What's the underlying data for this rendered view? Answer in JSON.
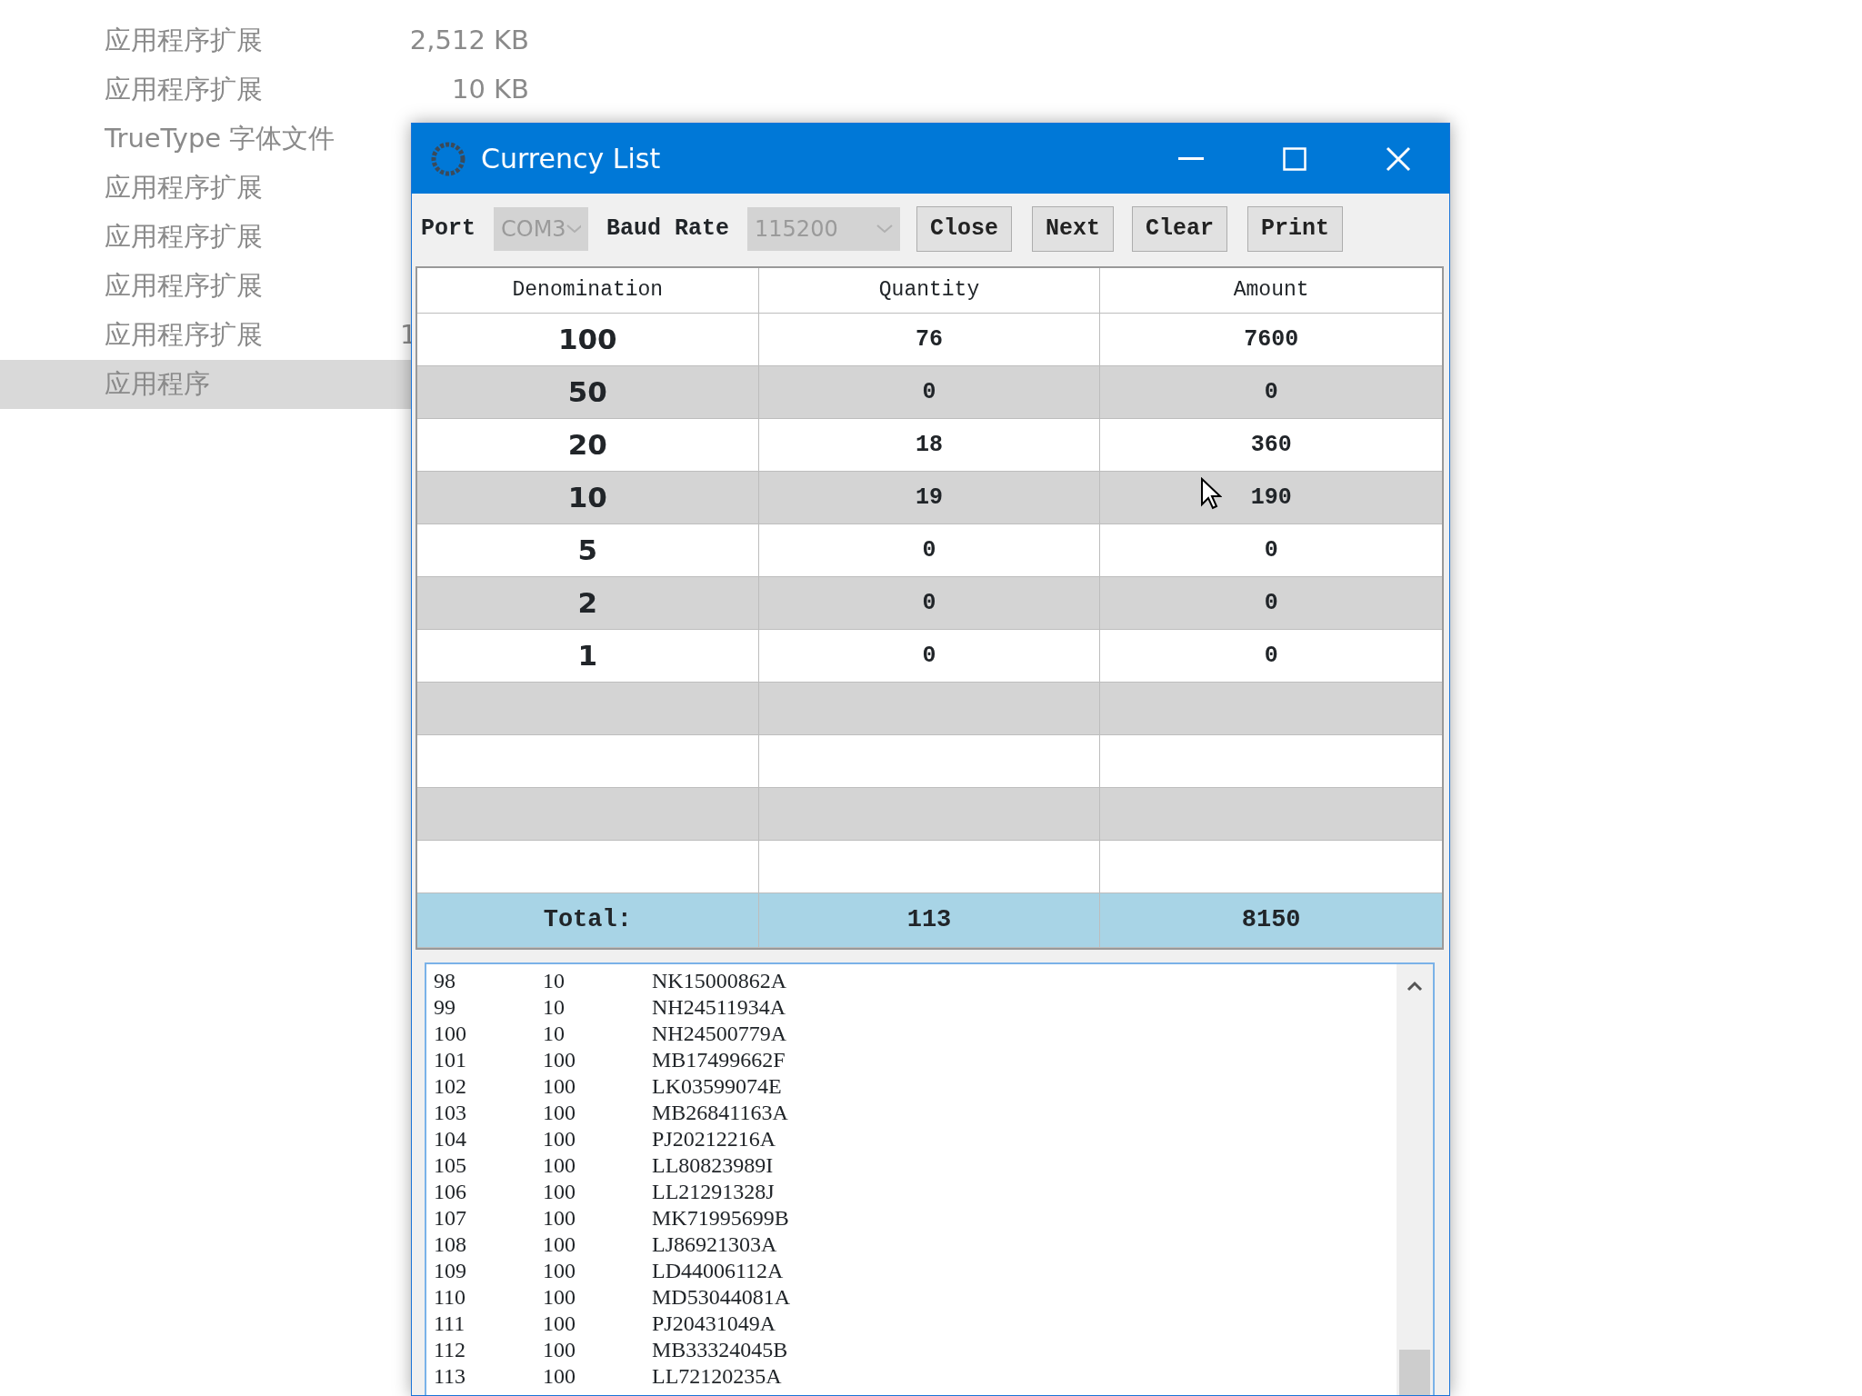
{
  "explorer": {
    "items": [
      {
        "type": "应用程序扩展",
        "size": "2,512 KB",
        "selected": false
      },
      {
        "type": "应用程序扩展",
        "size": "10 KB",
        "selected": false
      },
      {
        "type": "TrueType 字体文件",
        "selected": false
      },
      {
        "type": "应用程序扩展",
        "selected": false
      },
      {
        "type": "应用程序扩展",
        "selected": false
      },
      {
        "type": "应用程序扩展",
        "selected": false
      },
      {
        "type": "应用程序扩展",
        "size": "1",
        "clipped": true,
        "selected": false
      },
      {
        "type": "应用程序",
        "selected": true
      }
    ]
  },
  "window": {
    "title": "Currency List",
    "toolbar": {
      "port_label": "Port",
      "port": {
        "value": "COM3",
        "disabled": true
      },
      "baud_label": "Baud Rate",
      "baud": {
        "value": "115200",
        "disabled": true
      },
      "buttons": [
        "Close",
        "Next",
        "Clear",
        "Print"
      ]
    },
    "table": {
      "columns": [
        "Denomination",
        "Quantity",
        "Amount"
      ],
      "rows": [
        {
          "denomination": "100",
          "quantity": "76",
          "amount": "7600"
        },
        {
          "denomination": "50",
          "quantity": "0",
          "amount": "0"
        },
        {
          "denomination": "20",
          "quantity": "18",
          "amount": "360"
        },
        {
          "denomination": "10",
          "quantity": "19",
          "amount": "190"
        },
        {
          "denomination": "5",
          "quantity": "0",
          "amount": "0"
        },
        {
          "denomination": "2",
          "quantity": "0",
          "amount": "0"
        },
        {
          "denomination": "1",
          "quantity": "0",
          "amount": "0"
        },
        {
          "kind": "blank"
        },
        {
          "kind": "blank"
        },
        {
          "kind": "blank"
        },
        {
          "kind": "blank"
        }
      ],
      "total": {
        "label": "Total:",
        "quantity": "113",
        "amount": "8150"
      }
    },
    "log": [
      [
        "98",
        "10",
        "NK15000862A"
      ],
      [
        "99",
        "10",
        "NH24511934A"
      ],
      [
        "100",
        "10",
        "NH24500779A"
      ],
      [
        "101",
        "100",
        "MB17499662F"
      ],
      [
        "102",
        "100",
        "LK03599074E"
      ],
      [
        "103",
        "100",
        "MB26841163A"
      ],
      [
        "104",
        "100",
        "PJ20212216A"
      ],
      [
        "105",
        "100",
        "LL80823989I"
      ],
      [
        "106",
        "100",
        "LL21291328J"
      ],
      [
        "107",
        "100",
        "MK71995699B"
      ],
      [
        "108",
        "100",
        "LJ86921303A"
      ],
      [
        "109",
        "100",
        "LD44006112A"
      ],
      [
        "110",
        "100",
        "MD53044081A"
      ],
      [
        "111",
        "100",
        "PJ20431049A"
      ],
      [
        "112",
        "100",
        "MB33324045B"
      ],
      [
        "113",
        "100",
        "LL72120235A"
      ]
    ]
  }
}
